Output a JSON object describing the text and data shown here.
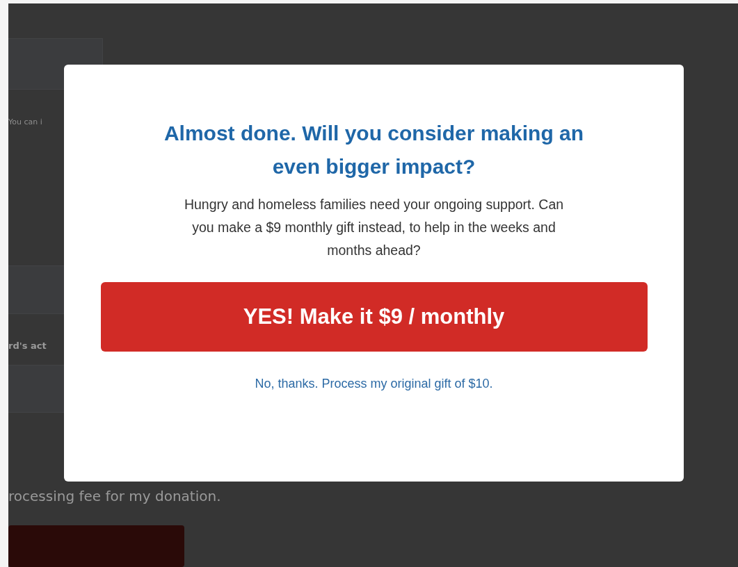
{
  "background": {
    "note": "You can i",
    "label": "rd's act",
    "fee_text": "rocessing fee for my donation."
  },
  "modal": {
    "title": "Almost done. Will you consider making an even bigger impact?",
    "message": "Hungry and homeless families need your ongoing support. Can you make a $9 monthly gift instead, to help in the weeks and months ahead?",
    "accept_button": "YES! Make it $9 / monthly",
    "decline_link": "No, thanks. Process my original gift of $10."
  }
}
